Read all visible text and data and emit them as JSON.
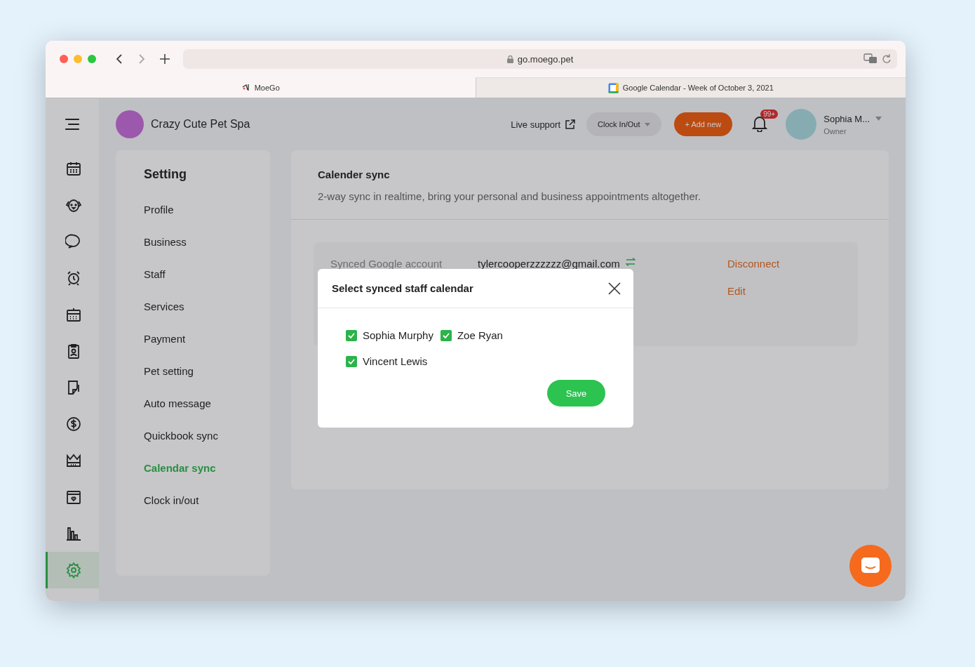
{
  "browser": {
    "url": "go.moego.pet",
    "tabs": [
      {
        "title": "MoeGo",
        "selected": true
      },
      {
        "title": "Google Calendar - Week of October 3, 2021",
        "selected": false
      }
    ]
  },
  "nav_rail": {
    "items": [
      {
        "kind": "calendar",
        "selected": false
      },
      {
        "kind": "dog",
        "selected": false
      },
      {
        "kind": "chat",
        "selected": false
      },
      {
        "kind": "alarm",
        "selected": false
      },
      {
        "kind": "schedule",
        "selected": false
      },
      {
        "kind": "badge",
        "selected": false
      },
      {
        "kind": "note",
        "selected": false
      },
      {
        "kind": "dollar",
        "selected": false
      },
      {
        "kind": "crown",
        "selected": false
      },
      {
        "kind": "heart-calendar",
        "selected": false
      },
      {
        "kind": "chart",
        "selected": false
      },
      {
        "kind": "gear",
        "selected": true
      }
    ]
  },
  "header": {
    "business_name": "Crazy Cute Pet Spa",
    "live_support": "Live support",
    "clock_button": "Clock In/Out",
    "add_button": "+ Add new",
    "notification_count": "99+",
    "user": {
      "name": "Sophia M...",
      "role": "Owner"
    }
  },
  "settings_menu": {
    "title": "Setting",
    "items": [
      {
        "label": "Profile",
        "selected": false
      },
      {
        "label": "Business",
        "selected": false
      },
      {
        "label": "Staff",
        "selected": false
      },
      {
        "label": "Services",
        "selected": false
      },
      {
        "label": "Payment",
        "selected": false
      },
      {
        "label": "Pet setting",
        "selected": false
      },
      {
        "label": "Auto message",
        "selected": false
      },
      {
        "label": "Quickbook sync",
        "selected": false
      },
      {
        "label": "Calendar sync",
        "selected": true
      },
      {
        "label": "Clock in/out",
        "selected": false
      }
    ]
  },
  "calendar_sync": {
    "title": "Calender sync",
    "description": "2-way sync in realtime, bring your personal and business appointments altogether.",
    "account_label": "Synced Google account",
    "account_email": "tylercooperzzzzzz@gmail.com",
    "actions": [
      "Disconnect",
      "Edit"
    ]
  },
  "modal": {
    "title": "Select synced staff calendar",
    "staff": [
      {
        "name": "Sophia Murphy",
        "checked": true
      },
      {
        "name": "Zoe Ryan",
        "checked": true
      },
      {
        "name": "Vincent Lewis",
        "checked": true
      }
    ],
    "save": "Save"
  }
}
